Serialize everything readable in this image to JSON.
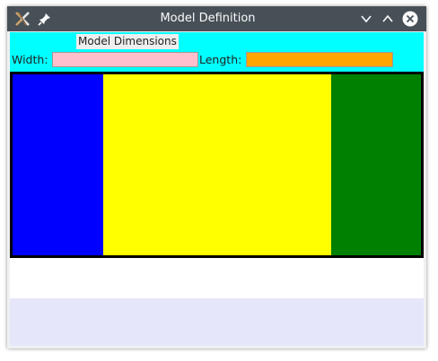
{
  "window": {
    "title": "Model Definition"
  },
  "form": {
    "panel_title": "Model Dimensions",
    "width_label": "Width:",
    "width_value": "",
    "length_label": "Length:",
    "length_value": ""
  },
  "drawing": {
    "zones": [
      {
        "name": "blue-zone",
        "color": "#0000ff"
      },
      {
        "name": "yellow-zone",
        "color": "#ffff00"
      },
      {
        "name": "green-zone",
        "color": "#008000"
      }
    ]
  },
  "colors": {
    "panel_bg": "#00ffff",
    "width_field_bg": "#ffc0cb",
    "length_field_bg": "#ffa500",
    "content_bg": "#e6e6fa",
    "titlebar_bg": "#475057"
  },
  "icons": {
    "app": "app-icon",
    "pin": "pin-icon",
    "minimize": "chevron-down-icon",
    "maximize": "chevron-up-icon",
    "close": "close-icon"
  }
}
